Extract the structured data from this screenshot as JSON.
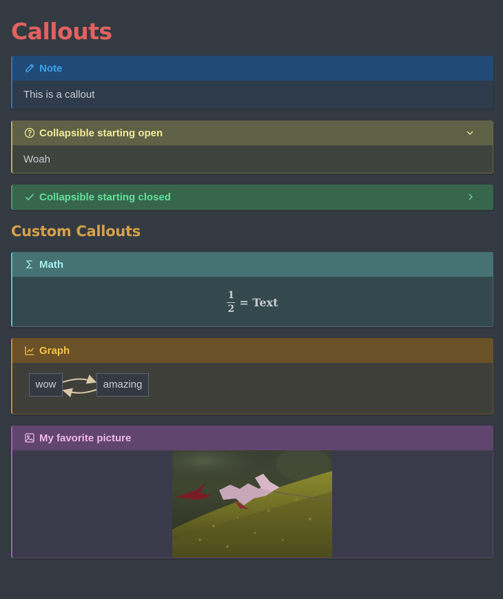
{
  "page": {
    "title": "Callouts"
  },
  "section": {
    "custom_title": "Custom Callouts"
  },
  "callouts": {
    "note": {
      "title": "Note",
      "icon": "pencil-icon",
      "body": "This is a callout",
      "color": "#3ea3e8"
    },
    "open": {
      "title": "Collapsible starting open",
      "icon": "question-circle-icon",
      "body": "Woah",
      "color": "#f0ea9c",
      "state": "expanded"
    },
    "closed": {
      "title": "Collapsible starting closed",
      "icon": "check-icon",
      "color": "#63e09a",
      "state": "collapsed"
    },
    "math": {
      "title": "Math",
      "icon": "sigma-icon",
      "numerator": "1",
      "denominator": "2",
      "equals_rhs": "= Text",
      "color": "#a8f0f0"
    },
    "graph": {
      "title": "Graph",
      "icon": "line-chart-icon",
      "nodes": [
        "wow",
        "amazing"
      ],
      "color": "#f5c24a"
    },
    "picture": {
      "title": "My favorite picture",
      "icon": "image-icon",
      "color": "#f0b6ee"
    }
  }
}
